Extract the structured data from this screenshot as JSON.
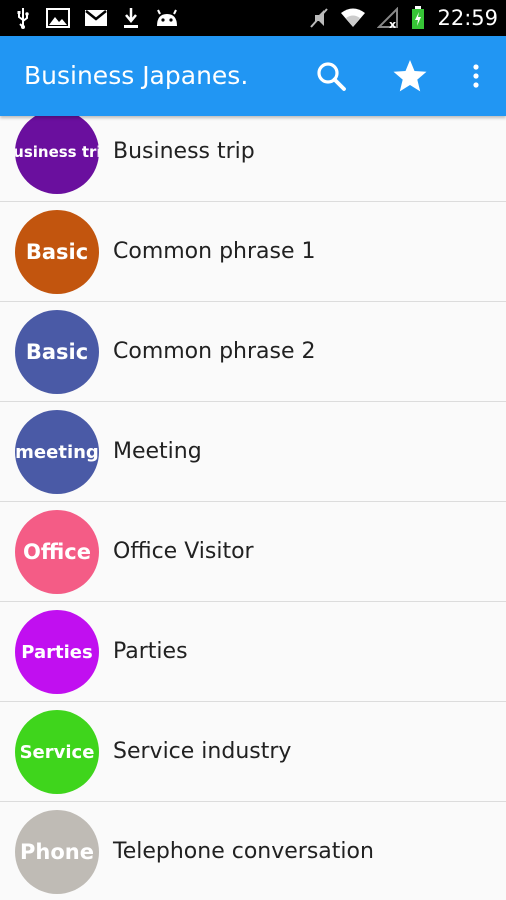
{
  "status_bar": {
    "left_icons": [
      "usb-icon",
      "image-icon",
      "gmail-icon",
      "download-icon",
      "android-icon"
    ],
    "right_icons": [
      "mute-icon",
      "wifi-icon",
      "no-signal-icon",
      "battery-charging-icon"
    ],
    "time": "22:59"
  },
  "app_bar": {
    "title": "Business Japanes.",
    "color": "#2196f3",
    "actions": [
      "search-icon",
      "star-icon",
      "overflow-menu-icon"
    ]
  },
  "categories": [
    {
      "badge": "Business trip",
      "label": "Business trip",
      "color": "#6a0f9e"
    },
    {
      "badge": "Basic",
      "label": "Common phrase 1",
      "color": "#c2550e"
    },
    {
      "badge": "Basic",
      "label": "Common phrase 2",
      "color": "#4a5aa6"
    },
    {
      "badge": "meeting",
      "label": "Meeting",
      "color": "#4a5aa6"
    },
    {
      "badge": "Office",
      "label": "Office Visitor",
      "color": "#f45c86"
    },
    {
      "badge": "Parties",
      "label": "Parties",
      "color": "#c10ff0"
    },
    {
      "badge": "Service",
      "label": "Service industry",
      "color": "#3fd51c"
    },
    {
      "badge": "Phone",
      "label": "Telephone conversation",
      "color": "#bfbbb5"
    }
  ]
}
